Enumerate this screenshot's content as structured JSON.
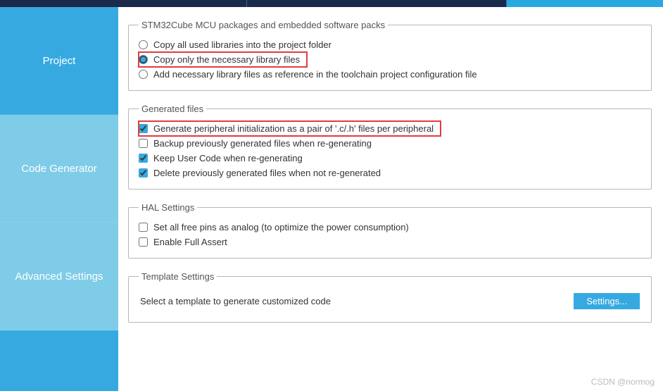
{
  "sidebar": {
    "items": [
      {
        "label": "Project"
      },
      {
        "label": "Code Generator"
      },
      {
        "label": "Advanced Settings"
      }
    ]
  },
  "packages": {
    "legend": "STM32Cube MCU packages and embedded software packs",
    "opt_copy_all": "Copy all used libraries into the project folder",
    "opt_copy_necessary": "Copy only the necessary library files",
    "opt_add_reference": "Add necessary library files as reference in the toolchain project configuration file"
  },
  "generated": {
    "legend": "Generated files",
    "opt_pair": "Generate peripheral initialization as a pair of '.c/.h' files per peripheral",
    "opt_backup": "Backup previously generated files when re-generating",
    "opt_keep": "Keep User Code when re-generating",
    "opt_delete": "Delete previously generated files when not re-generated"
  },
  "hal": {
    "legend": "HAL Settings",
    "opt_analog": "Set all free pins as analog (to optimize the power consumption)",
    "opt_assert": "Enable Full Assert"
  },
  "template": {
    "legend": "Template Settings",
    "desc": "Select a template to generate customized code",
    "button": "Settings..."
  },
  "watermark": "CSDN @normog"
}
